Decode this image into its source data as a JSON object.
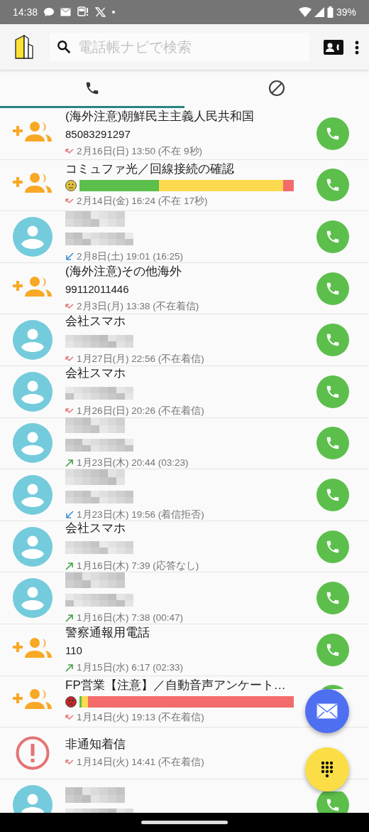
{
  "status_bar": {
    "time": "14:38",
    "battery": "39%"
  },
  "search": {
    "placeholder": "電話帳ナビで検索"
  },
  "tabs": [
    {
      "kind": "calls",
      "selected": true
    },
    {
      "kind": "blocked",
      "selected": false
    }
  ],
  "calls": [
    {
      "kind": "add_contact",
      "name": "(海外注意)朝鮮民主主義人民共和国",
      "number": "85083291297",
      "direction": {
        "kind": "missed"
      },
      "date": "2月16日(日) 13:50 (不在 9秒)"
    },
    {
      "kind": "add_contact",
      "name": "コミュファ光／回線接続の確認",
      "mood": {
        "kind": "neutral"
      },
      "rating": [
        {
          "color": "#f46b6b"
        },
        {
          "color": "#fdd94f",
          "level": 0.95
        },
        {
          "color": "#5cbf4c",
          "level": 0.37
        }
      ],
      "direction": {
        "kind": "missed"
      },
      "date": "2月14日(金) 16:24 (不在 17秒)"
    },
    {
      "kind": "contact",
      "name_hidden": true,
      "number_hidden": true,
      "direction": {
        "kind": "incoming"
      },
      "date": "2月8日(土) 19:01 (16:25)"
    },
    {
      "kind": "add_contact",
      "name": "(海外注意)その他海外",
      "number": "99112011446",
      "direction": {
        "kind": "missed"
      },
      "date": "2月3日(月) 13:38 (不在着信)"
    },
    {
      "kind": "contact",
      "name": "会社スマホ",
      "number_hidden": true,
      "direction": {
        "kind": "missed"
      },
      "date": "1月27日(月) 22:56 (不在着信)"
    },
    {
      "kind": "contact",
      "name": "会社スマホ",
      "number_hidden": true,
      "direction": {
        "kind": "missed"
      },
      "date": "1月26日(日) 20:26 (不在着信)"
    },
    {
      "kind": "contact",
      "name_hidden": true,
      "number_hidden": true,
      "direction": {
        "kind": "outgoing"
      },
      "date": "1月23日(木) 20:44 (03:23)"
    },
    {
      "kind": "contact",
      "name_hidden": true,
      "number_hidden": true,
      "direction": {
        "kind": "incoming"
      },
      "date": "1月23日(木) 19:56 (着信拒否)"
    },
    {
      "kind": "contact",
      "name": "会社スマホ",
      "number_hidden": true,
      "direction": {
        "kind": "outgoing"
      },
      "date": "1月16日(木) 7:39 (応答なし)"
    },
    {
      "kind": "contact",
      "name_hidden": true,
      "number_hidden": true,
      "direction": {
        "kind": "outgoing"
      },
      "date": "1月16日(木) 7:38 (00:47)"
    },
    {
      "kind": "add_contact",
      "name": "警察通報用電話",
      "number": "110",
      "direction": {
        "kind": "outgoing"
      },
      "date": "1月15日(水) 6:17 (02:33)"
    },
    {
      "kind": "add_contact",
      "name": "FP営業【注意】／自動音声アンケート…",
      "mood": {
        "kind": "angry"
      },
      "rating": [
        {
          "color": "#f46b6b"
        },
        {
          "color": "#fdd94f",
          "level": 0.04
        },
        {
          "color": "#5cbf4c",
          "level": 0.01
        }
      ],
      "direction": {
        "kind": "missed"
      },
      "date": "1月14日(火) 19:13 (不在着信)"
    },
    {
      "kind": "alert",
      "name": "非通知着信",
      "direction": {
        "kind": "missed"
      },
      "date": "1月14日(火) 14:41 (不在着信)",
      "call_hidden": true
    },
    {
      "kind": "contact",
      "name_hidden": true,
      "number_hidden": true
    }
  ],
  "fabs": [
    {
      "kind": "mail"
    },
    {
      "kind": "dialpad"
    }
  ]
}
